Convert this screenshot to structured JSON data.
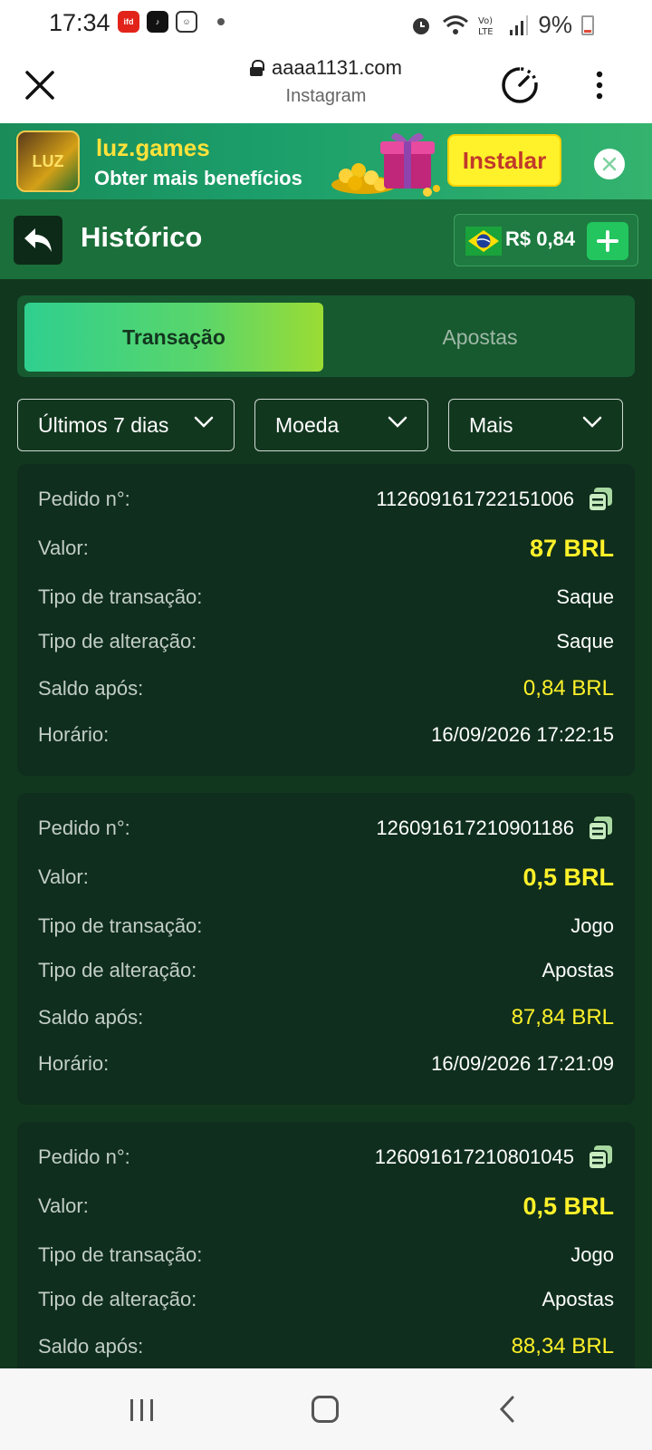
{
  "status": {
    "time": "17:34",
    "battery": "9%"
  },
  "browser": {
    "url": "aaaa1131.com",
    "subtitle": "Instagram"
  },
  "banner": {
    "app_name": "luz.games",
    "tagline": "Obter mais benefícios",
    "logo_text": "LUZ",
    "install_label": "Instalar"
  },
  "header": {
    "title": "Histórico",
    "balance": "R$ 0,84"
  },
  "tabs": [
    {
      "label": "Transação",
      "active": true
    },
    {
      "label": "Apostas",
      "active": false
    }
  ],
  "filters": {
    "period": "Últimos 7 dias",
    "currency": "Moeda",
    "more": "Mais"
  },
  "labels": {
    "order": "Pedido n°:",
    "value": "Valor:",
    "transaction_type": "Tipo de transação:",
    "change_type": "Tipo de alteração:",
    "balance_after": "Saldo após:",
    "time": "Horário:"
  },
  "transactions": [
    {
      "order": "112609161722151006",
      "value": "87 BRL",
      "transaction_type": "Saque",
      "change_type": "Saque",
      "balance_after": "0,84 BRL",
      "time": "16/09/2026 17:22:15"
    },
    {
      "order": "126091617210901186",
      "value": "0,5 BRL",
      "transaction_type": "Jogo",
      "change_type": "Apostas",
      "balance_after": "87,84 BRL",
      "time": "16/09/2026 17:21:09"
    },
    {
      "order": "126091617210801045",
      "value": "0,5 BRL",
      "transaction_type": "Jogo",
      "change_type": "Apostas",
      "balance_after": "88,34 BRL",
      "time": ""
    }
  ],
  "colors": {
    "background": "#12371f",
    "header": "#1b6f3a",
    "card": "#0f2e1d",
    "accent_yellow": "#fff12a",
    "accent_green": "#22c55e"
  }
}
